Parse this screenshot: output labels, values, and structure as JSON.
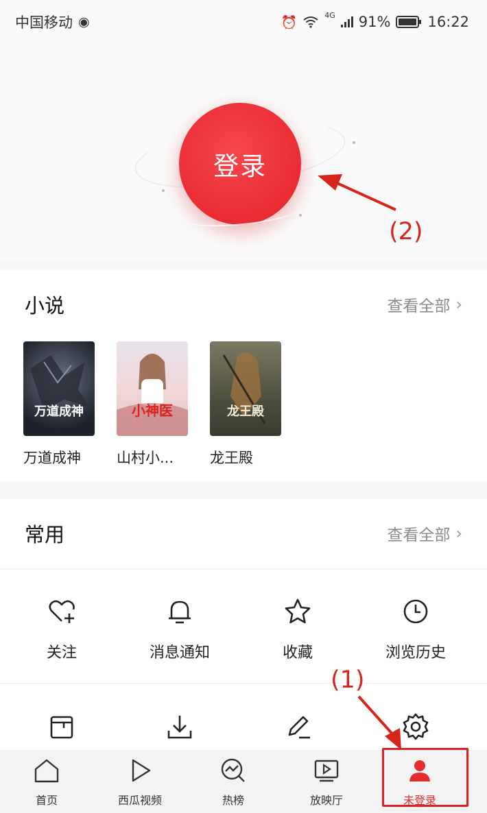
{
  "status_bar": {
    "carrier": "中国移动",
    "network": "4G",
    "battery": "91%",
    "time": "16:22"
  },
  "hero": {
    "login_label": "登录"
  },
  "annotations": {
    "label_1": "(1)",
    "label_2": "(2)",
    "color": "#d6251b"
  },
  "novels": {
    "title": "小说",
    "see_all": "查看全部",
    "books": [
      {
        "name": "万道成神",
        "cover_text": "万道成神"
      },
      {
        "name": "山村小...",
        "cover_text": "小神医"
      },
      {
        "name": "龙王殿",
        "cover_text": "龙王殿"
      }
    ]
  },
  "common": {
    "title": "常用",
    "see_all": "查看全部",
    "items": [
      {
        "label": "关注",
        "icon": "heart-plus-icon"
      },
      {
        "label": "消息通知",
        "icon": "bell-icon"
      },
      {
        "label": "收藏",
        "icon": "star-icon"
      },
      {
        "label": "浏览历史",
        "icon": "clock-icon"
      }
    ],
    "row2_icons": [
      "wallet-icon",
      "download-icon",
      "edit-icon",
      "gear-icon"
    ]
  },
  "bottom_nav": {
    "items": [
      {
        "label": "首页",
        "icon": "home-icon"
      },
      {
        "label": "西瓜视频",
        "icon": "play-icon"
      },
      {
        "label": "热榜",
        "icon": "trending-icon"
      },
      {
        "label": "放映厅",
        "icon": "screen-play-icon"
      },
      {
        "label": "未登录",
        "icon": "person-icon",
        "active": true
      }
    ]
  },
  "colors": {
    "accent": "#ea2b32",
    "nav_active": "#e52d2d"
  }
}
